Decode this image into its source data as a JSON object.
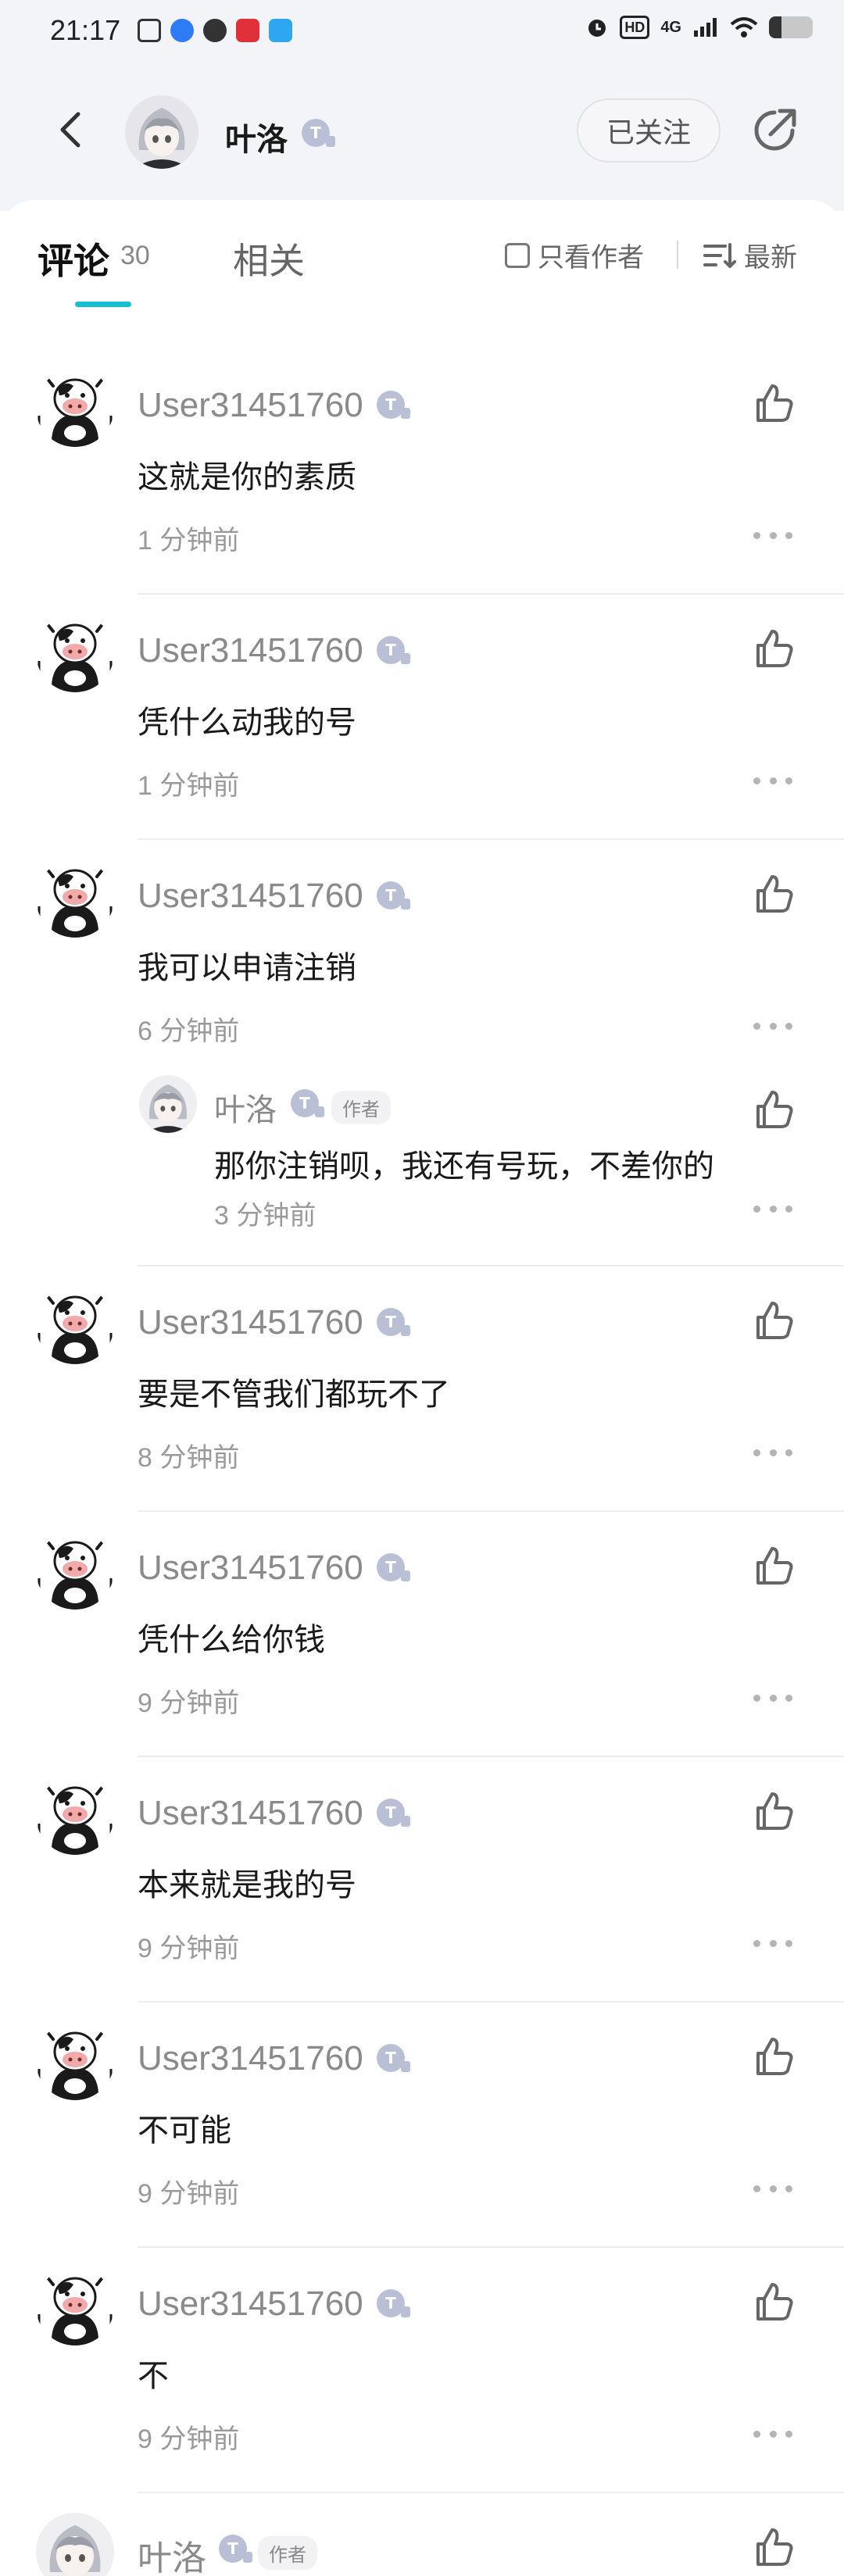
{
  "status_bar": {
    "time": "21:17",
    "hd": "HD",
    "network": "4G"
  },
  "header": {
    "name": "叶洛",
    "follow_label": "已关注"
  },
  "tabs": {
    "comments_label": "评论",
    "comments_count": "30",
    "related_label": "相关",
    "author_only_label": "只看作者",
    "sort_label": "最新"
  },
  "comments": [
    {
      "user": "User31451760",
      "text": "这就是你的素质",
      "time": "1 分钟前"
    },
    {
      "user": "User31451760",
      "text": "凭什么动我的号",
      "time": "1 分钟前"
    },
    {
      "user": "User31451760",
      "text": "我可以申请注销",
      "time": "6 分钟前",
      "reply": {
        "user": "叶洛",
        "badge": "作者",
        "text": "那你注销呗，我还有号玩，不差你的",
        "time": "3 分钟前"
      }
    },
    {
      "user": "User31451760",
      "text": "要是不管我们都玩不了",
      "time": "8 分钟前"
    },
    {
      "user": "User31451760",
      "text": "凭什么给你钱",
      "time": "9 分钟前"
    },
    {
      "user": "User31451760",
      "text": "本来就是我的号",
      "time": "9 分钟前"
    },
    {
      "user": "User31451760",
      "text": "不可能",
      "time": "9 分钟前"
    },
    {
      "user": "User31451760",
      "text": "不",
      "time": "9 分钟前"
    }
  ],
  "last_comment": {
    "user": "叶洛",
    "badge": "作者"
  },
  "colors": {
    "accent": "#16c0d0",
    "background_top": "#f3f4f7",
    "level_badge": "#b9c0d6"
  },
  "icons": [
    "back-icon",
    "share-icon",
    "like-icon",
    "more-icon",
    "checkbox-icon",
    "sort-icon",
    "level-icon"
  ]
}
